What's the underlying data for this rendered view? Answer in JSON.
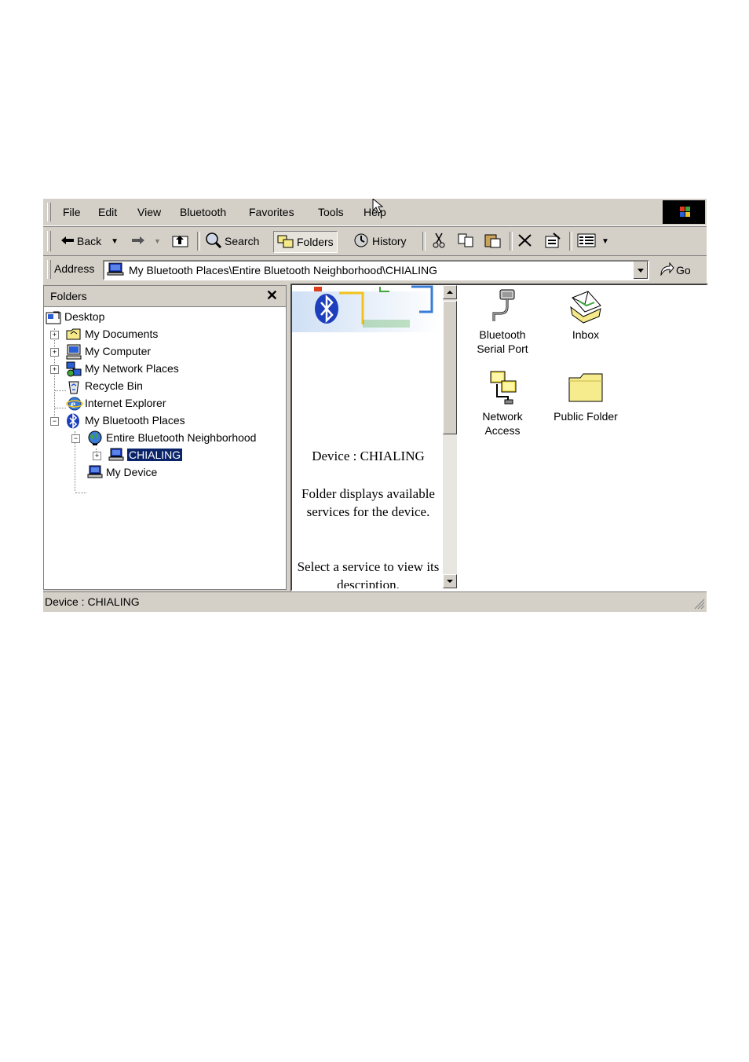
{
  "menu": [
    "File",
    "Edit",
    "View",
    "Bluetooth",
    "Favorites",
    "Tools",
    "Help"
  ],
  "toolbar": {
    "back": "Back",
    "search": "Search",
    "folders": "Folders",
    "history": "History"
  },
  "address": {
    "label": "Address",
    "path": "My Bluetooth Places\\Entire Bluetooth Neighborhood\\CHIALING",
    "go": "Go"
  },
  "folders_pane": {
    "title": "Folders",
    "close": "✕",
    "tree": [
      {
        "label": "Desktop",
        "icon": "desktop-icon"
      },
      {
        "label": "My Documents",
        "icon": "folder-icon"
      },
      {
        "label": "My Computer",
        "icon": "computer-icon"
      },
      {
        "label": "My Network Places",
        "icon": "network-icon"
      },
      {
        "label": "Recycle Bin",
        "icon": "recycle-bin-icon"
      },
      {
        "label": "Internet Explorer",
        "icon": "internet-explorer-icon"
      },
      {
        "label": "My Bluetooth Places",
        "icon": "bluetooth-icon"
      },
      {
        "label": "Entire Bluetooth Neighborhood",
        "icon": "globe-icon"
      },
      {
        "label": "CHIALING",
        "icon": "laptop-icon"
      },
      {
        "label": "My Device",
        "icon": "laptop-icon"
      }
    ]
  },
  "webview": {
    "device": "Device : CHIALING",
    "line1": "Folder displays available",
    "line2": "services for the device.",
    "line3": "Select a service to view its",
    "line4": "description."
  },
  "services": [
    {
      "line1": "Bluetooth",
      "line2": "Serial Port",
      "icon": "serial-port-icon"
    },
    {
      "line1": "Inbox",
      "line2": "",
      "icon": "inbox-icon"
    },
    {
      "line1": "Network",
      "line2": "Access",
      "icon": "network-access-icon"
    },
    {
      "line1": "Public Folder",
      "line2": "",
      "icon": "folder-icon"
    }
  ],
  "status": "Device : CHIALING",
  "colors": {
    "selection": "#0a246a",
    "bluetooth": "#1e3fbd",
    "chrome": "#d4d0c8"
  }
}
